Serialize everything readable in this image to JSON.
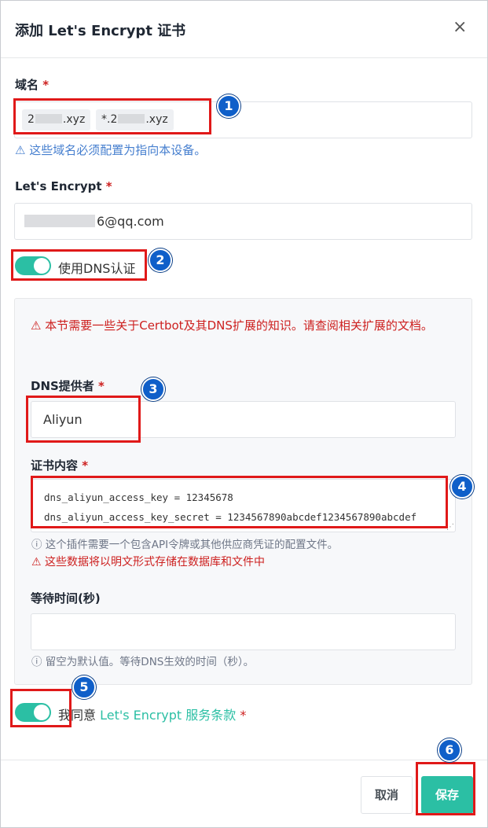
{
  "dialog": {
    "title": "添加 Let's Encrypt 证书",
    "close_icon": "×"
  },
  "domain": {
    "label": "域名",
    "required": "*",
    "tags": [
      {
        "prefix": "2",
        "suffix": ".xyz"
      },
      {
        "prefix": "*.2",
        "suffix": ".xyz"
      }
    ],
    "hint_icon": "⚠",
    "hint": "这些域名必须配置为指向本设备。"
  },
  "email": {
    "label": "Let's Encrypt",
    "required": "*",
    "value_suffix": "6@qq.com"
  },
  "dns_toggle": {
    "label": "使用DNS认证",
    "on": true
  },
  "dns_card": {
    "warning_icon": "⚠",
    "warning": "本节需要一些关于Certbot及其DNS扩展的知识。请查阅相关扩展的文档。",
    "provider": {
      "label": "DNS提供者",
      "required": "*",
      "value": "Aliyun"
    },
    "credentials": {
      "label": "证书内容",
      "required": "*",
      "lines": [
        "dns_aliyun_access_key = 12345678",
        "dns_aliyun_access_key_secret = 1234567890abcdef1234567890abcdef"
      ],
      "hint_icon": "ⓘ",
      "hint": "这个插件需要一个包含API令牌或其他供应商凭证的配置文件。",
      "warn_icon": "⚠",
      "warn": "这些数据将以明文形式存储在数据库和文件中"
    },
    "propagation": {
      "label": "等待时间(秒)",
      "value": "",
      "hint_icon": "ⓘ",
      "hint": "留空为默认值。等待DNS生效的时间（秒）。"
    }
  },
  "agree": {
    "prefix": "我同意",
    "link": "Let's Encrypt 服务条款",
    "required": "*",
    "on": true
  },
  "footer": {
    "cancel": "取消",
    "save": "保存"
  },
  "annotations": [
    "1",
    "2",
    "3",
    "4",
    "5",
    "6"
  ],
  "colors": {
    "accent": "#2bbfa4",
    "danger": "#cd201f",
    "info": "#467fcf",
    "annotation_box": "#e01919",
    "annotation_badge": "#0f5fc9"
  }
}
